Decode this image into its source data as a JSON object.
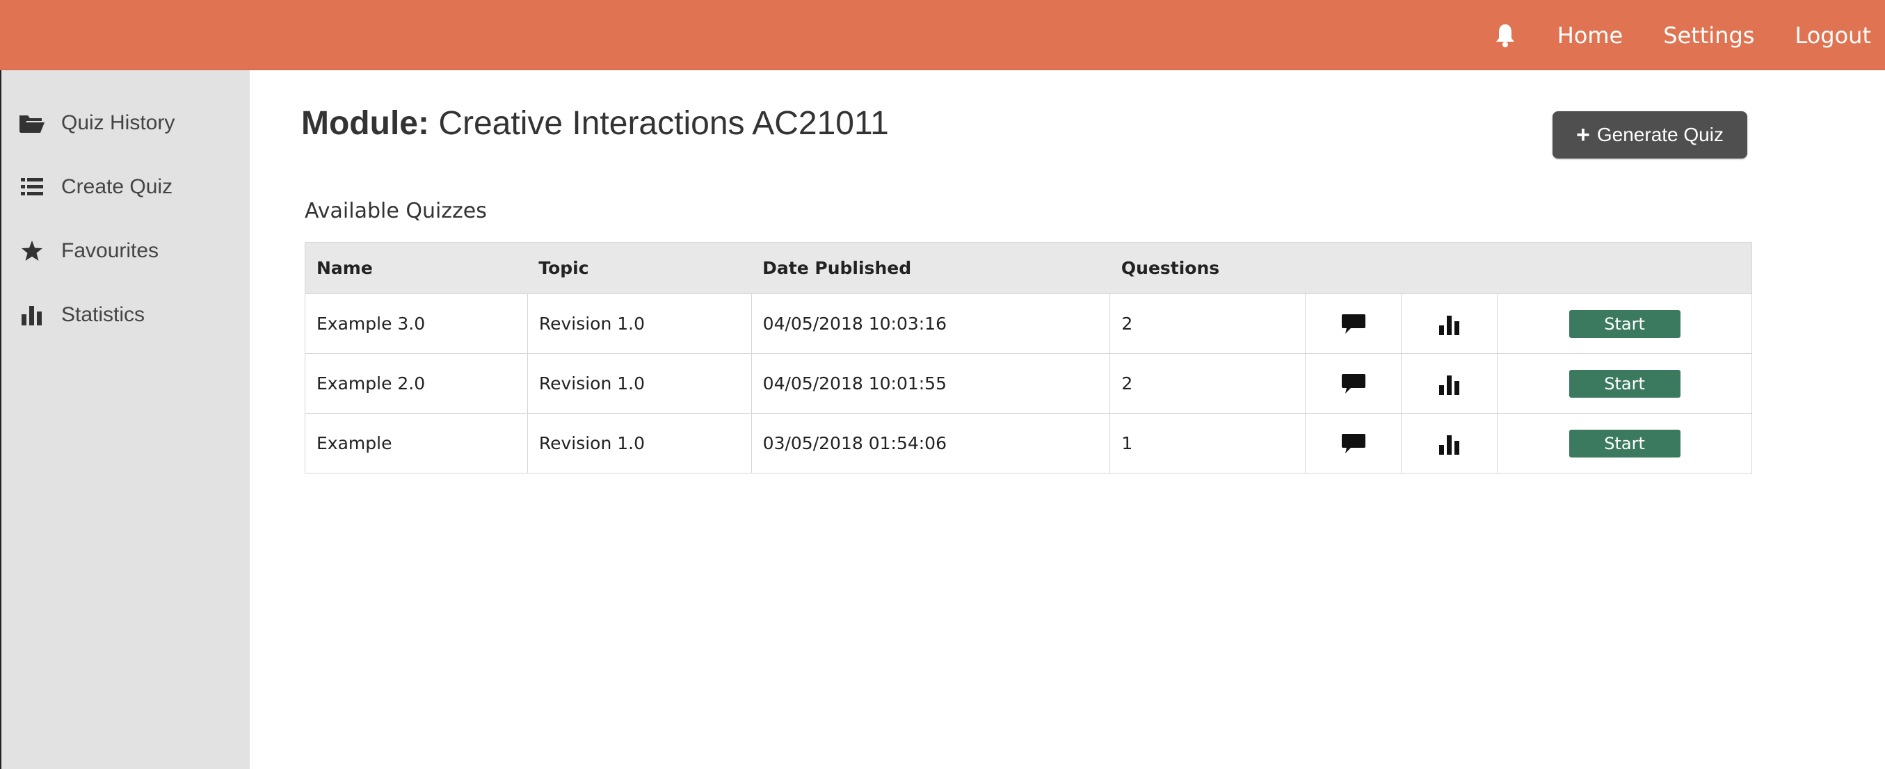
{
  "topbar": {
    "bell_icon": "bell-icon",
    "links": [
      "Home",
      "Settings",
      "Logout"
    ]
  },
  "sidebar": {
    "items": [
      {
        "label": "Quiz History",
        "icon": "folder-open-icon"
      },
      {
        "label": "Create Quiz",
        "icon": "list-icon"
      },
      {
        "label": "Favourites",
        "icon": "star-icon"
      },
      {
        "label": "Statistics",
        "icon": "bar-chart-icon"
      }
    ]
  },
  "main": {
    "title_prefix": "Module:",
    "title_value": "Creative Interactions AC21011",
    "generate_button": "Generate Quiz",
    "section_title": "Available Quizzes",
    "table": {
      "headers": [
        "Name",
        "Topic",
        "Date Published",
        "Questions"
      ],
      "rows": [
        {
          "name": "Example 3.0",
          "topic": "Revision 1.0",
          "date": "04/05/2018 10:03:16",
          "questions": "2",
          "action": "Start"
        },
        {
          "name": "Example 2.0",
          "topic": "Revision 1.0",
          "date": "04/05/2018 10:01:55",
          "questions": "2",
          "action": "Start"
        },
        {
          "name": "Example",
          "topic": "Revision 1.0",
          "date": "03/05/2018 01:54:06",
          "questions": "1",
          "action": "Start"
        }
      ]
    }
  },
  "colors": {
    "topbar": "#e07452",
    "sidebar": "#e2e2e2",
    "generate_button": "#4f4f4f",
    "start_button": "#3c7a60"
  }
}
